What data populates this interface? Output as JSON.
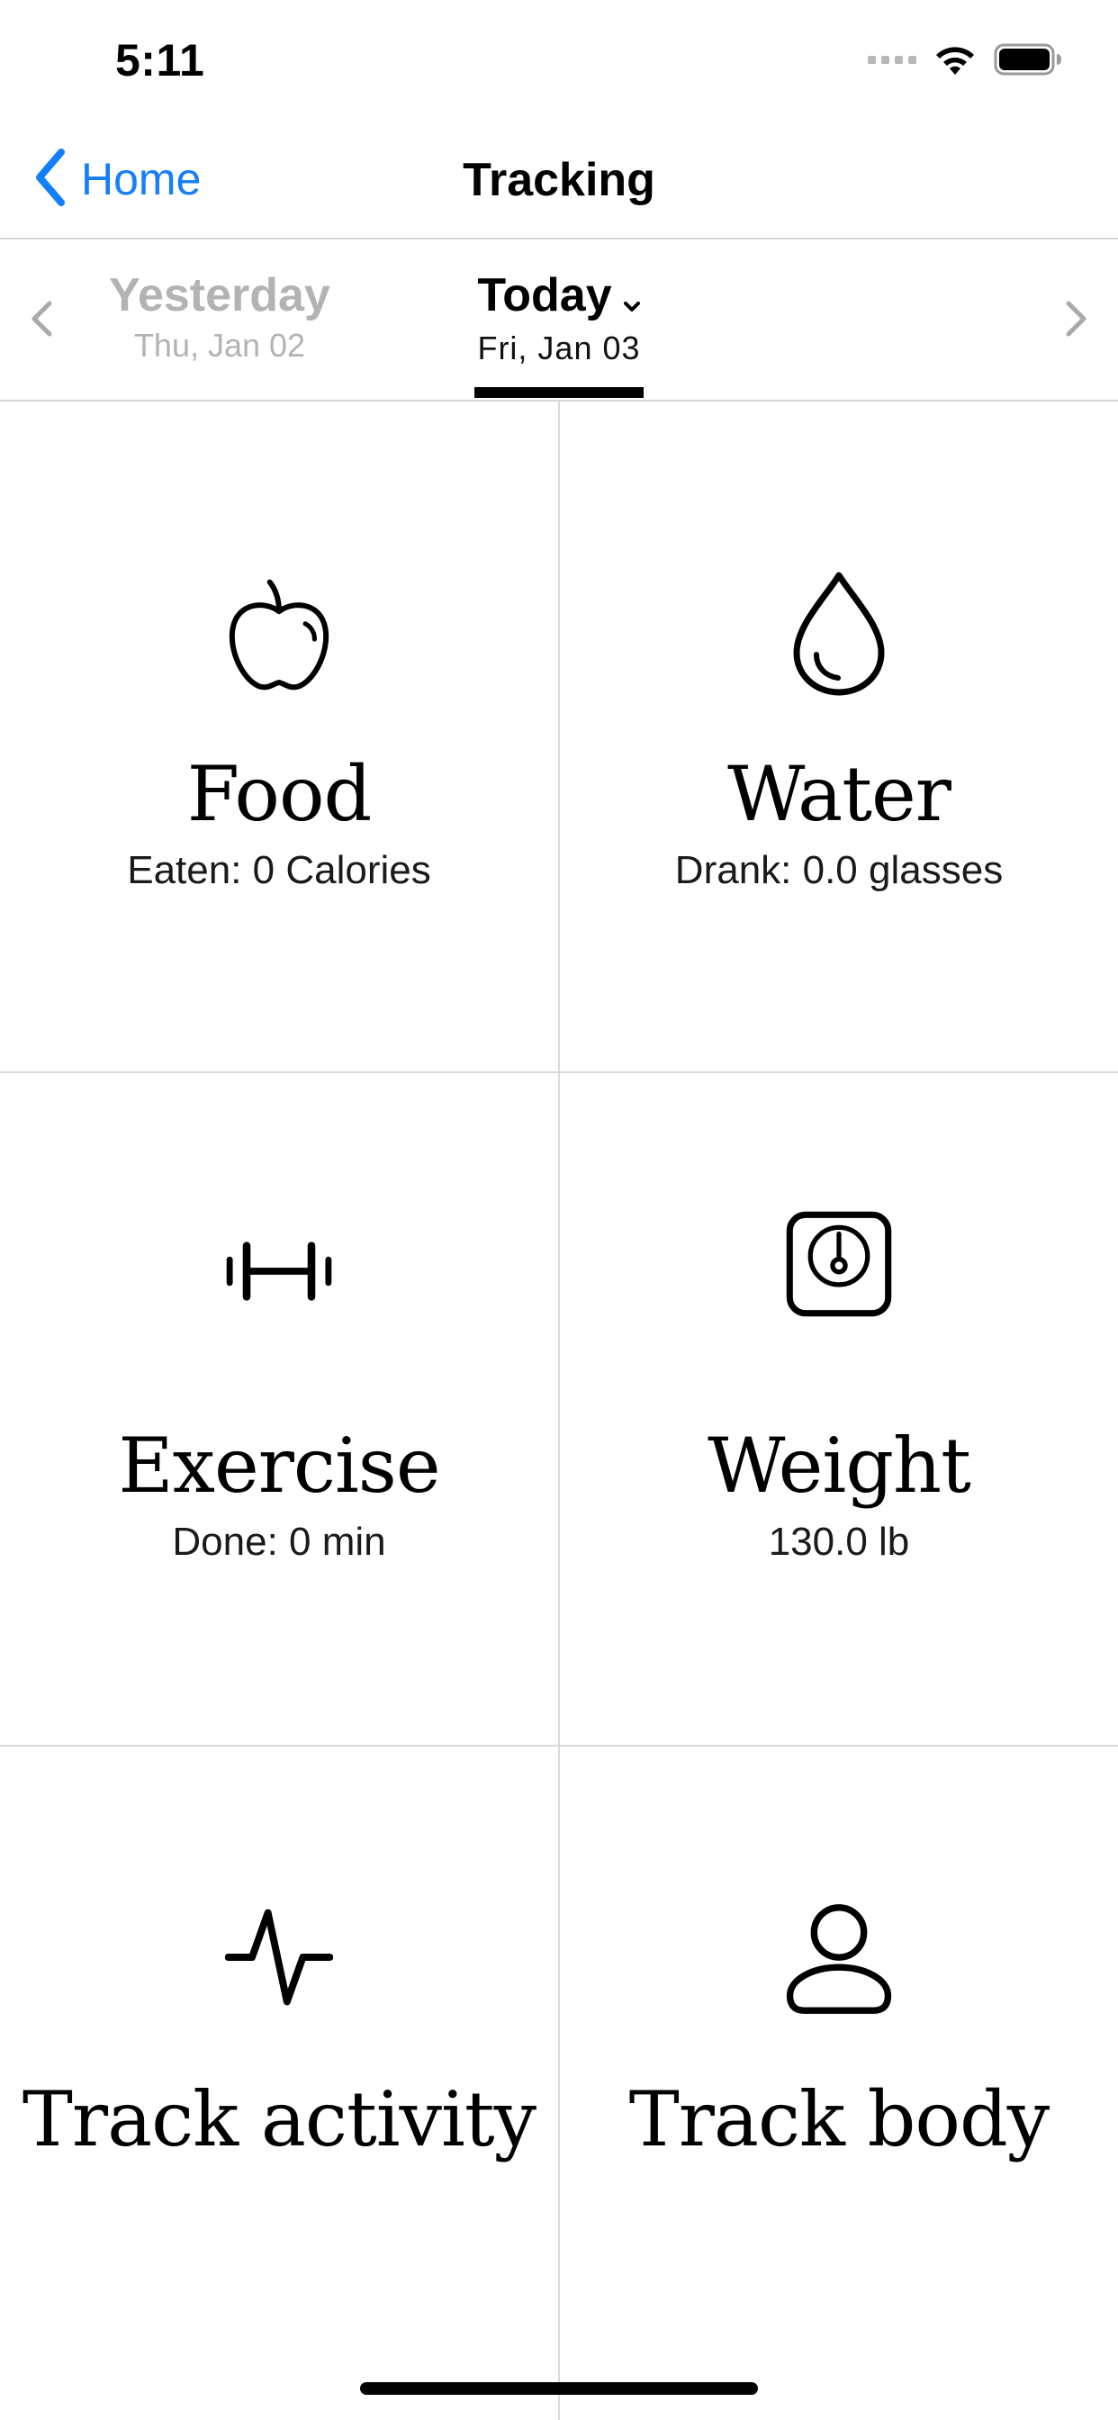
{
  "status_bar": {
    "time": "5:11",
    "icons": [
      "cellular-signal-icon",
      "wifi-icon",
      "battery-icon"
    ]
  },
  "nav": {
    "back_label": "Home",
    "back_icon": "chevron-left-icon",
    "title": "Tracking",
    "accent_color": "#157efb"
  },
  "date_selector": {
    "previous": {
      "label": "Yesterday",
      "date": "Thu, Jan 02"
    },
    "current": {
      "label": "Today",
      "date": "Fri, Jan 03",
      "icon": "chevron-down-icon"
    },
    "prev_arrow_icon": "chevron-left-icon",
    "next_arrow_icon": "chevron-right-icon"
  },
  "tiles": {
    "food": {
      "title": "Food",
      "subtitle": "Eaten: 0 Calories",
      "icon": "apple-icon"
    },
    "water": {
      "title": "Water",
      "subtitle": "Drank: 0.0 glasses",
      "icon": "water-drop-icon"
    },
    "exercise": {
      "title": "Exercise",
      "subtitle": "Done: 0 min",
      "icon": "dumbbell-icon"
    },
    "weight": {
      "title": "Weight",
      "subtitle": "130.0 lb",
      "icon": "scale-icon"
    },
    "activity": {
      "title": "Track activity",
      "icon": "pulse-icon"
    },
    "body": {
      "title": "Track body",
      "icon": "person-icon"
    }
  }
}
